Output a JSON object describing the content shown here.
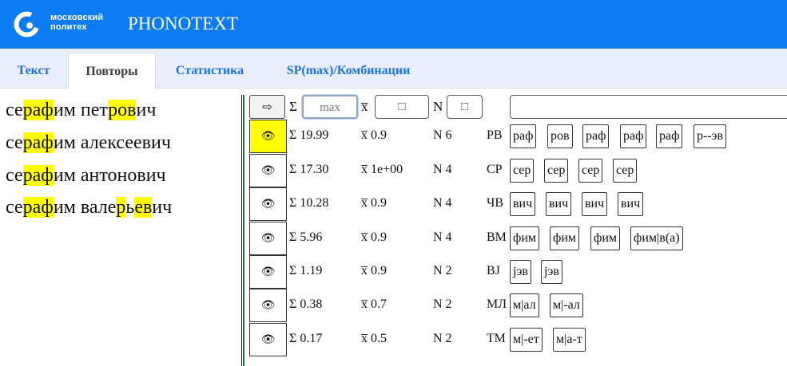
{
  "header": {
    "logo_line1": "московский",
    "logo_line2": "политех",
    "app_title": "PHONOTEXT",
    "brand_color": "#0d7cf2"
  },
  "tabs": [
    {
      "label": "Текст",
      "active": false
    },
    {
      "label": "Повторы",
      "active": true
    },
    {
      "label": "Статистика",
      "active": false
    },
    {
      "label": "SP(max)/Комбинации",
      "active": false
    }
  ],
  "text_lines": [
    [
      {
        "t": "се"
      },
      {
        "t": "раф",
        "hl": true
      },
      {
        "t": "им пет"
      },
      {
        "t": "ров",
        "hl": true
      },
      {
        "t": "ич"
      }
    ],
    [
      {
        "t": "се"
      },
      {
        "t": "раф",
        "hl": true
      },
      {
        "t": "им алексеевич"
      }
    ],
    [
      {
        "t": "се"
      },
      {
        "t": "раф",
        "hl": true
      },
      {
        "t": "им антонович"
      }
    ],
    [
      {
        "t": "се"
      },
      {
        "t": "раф",
        "hl": true
      },
      {
        "t": "им вале"
      },
      {
        "t": "р",
        "hl": true
      },
      {
        "t": "ь"
      },
      {
        "t": "ев",
        "hl": true
      },
      {
        "t": "ич"
      }
    ]
  ],
  "controls": {
    "apply_icon": "⇨",
    "sigma": "Σ",
    "sigma_placeholder": "max",
    "xbar": "x̅",
    "xbar_placeholder": "□",
    "n": "N",
    "n_placeholder": "□",
    "search_value": ""
  },
  "rows": [
    {
      "selected": true,
      "sum": "Σ 19.99",
      "mean": "x̅  0.9",
      "n": "N 6",
      "code": "РВ",
      "chips": [
        "раф",
        "ров",
        "раф",
        "раф",
        "раф",
        "р--эв"
      ]
    },
    {
      "selected": false,
      "sum": "Σ 17.30",
      "mean": "x̅  1e+00",
      "n": "N 4",
      "code": "СР",
      "chips": [
        "сер",
        "сер",
        "сер",
        "сер"
      ]
    },
    {
      "selected": false,
      "sum": "Σ 10.28",
      "mean": "x̅  0.9",
      "n": "N 4",
      "code": "ЧВ",
      "chips": [
        "вич",
        "вич",
        "вич",
        "вич"
      ]
    },
    {
      "selected": false,
      "sum": "Σ 5.96",
      "mean": "x̅  0.9",
      "n": "N 4",
      "code": "ВМ",
      "chips": [
        "фим",
        "фим",
        "фим",
        "фим|в(а)"
      ]
    },
    {
      "selected": false,
      "sum": "Σ 1.19",
      "mean": "x̅  0.9",
      "n": "N 2",
      "code": "BJ",
      "chips": [
        "jэв",
        "jэв"
      ]
    },
    {
      "selected": false,
      "sum": "Σ 0.38",
      "mean": "x̅  0.7",
      "n": "N 2",
      "code": "МЛ",
      "chips": [
        "м|ал",
        "м|-ал"
      ]
    },
    {
      "selected": false,
      "sum": "Σ 0.17",
      "mean": "x̅  0.5",
      "n": "N 2",
      "code": "ТМ",
      "chips": [
        "м|-ет",
        "м|а-т"
      ]
    }
  ],
  "eye_icon": "👁",
  "highlight_color": "#ffff00"
}
